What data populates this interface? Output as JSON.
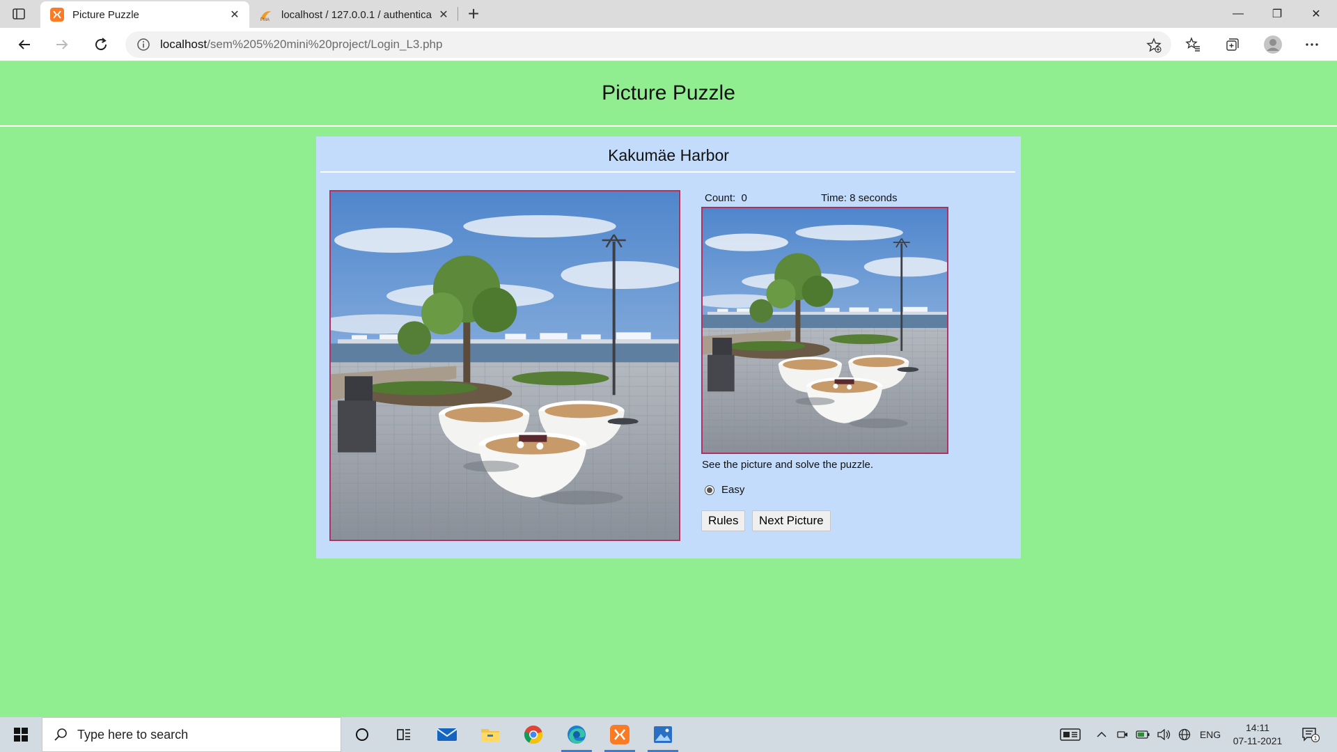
{
  "browser": {
    "tabs": [
      {
        "title": "Picture Puzzle",
        "active": true,
        "icon": "xampp-icon"
      },
      {
        "title": "localhost / 127.0.0.1 / authentica",
        "active": false,
        "icon": "phpmyadmin-icon"
      }
    ],
    "address": {
      "host": "localhost",
      "path": "/sem%205%20mini%20project/Login_L3.php"
    }
  },
  "page": {
    "title": "Picture Puzzle",
    "picture_name": "Kakumäe Harbor",
    "count_label": "Count:",
    "count_value": "0",
    "time_label": "Time:",
    "time_value": "8 seconds",
    "hint": "See the picture and solve the puzzle.",
    "difficulty": {
      "label": "Easy",
      "selected": true
    },
    "buttons": {
      "rules": "Rules",
      "next": "Next Picture"
    }
  },
  "puzzle": {
    "grid": 3,
    "empty_tile": 9,
    "tiles": [
      {
        "position": 1,
        "piece": 1
      },
      {
        "position": 2,
        "piece": 2
      },
      {
        "position": 3,
        "piece": 3
      },
      {
        "position": 4,
        "piece": 4
      },
      {
        "position": 5,
        "piece": 5
      },
      {
        "position": 6,
        "piece": 6
      },
      {
        "position": 7,
        "piece": 7
      },
      {
        "position": 8,
        "piece": 8
      },
      {
        "position": 9,
        "piece": 9
      }
    ]
  },
  "taskbar": {
    "search_placeholder": "Type here to search",
    "language": "ENG",
    "time": "14:11",
    "date": "07-11-2021",
    "notification_count": "1"
  },
  "colors": {
    "page_background": "#90ee90",
    "panel_background": "#c3dcfb",
    "puzzle_border": "#b03060"
  }
}
